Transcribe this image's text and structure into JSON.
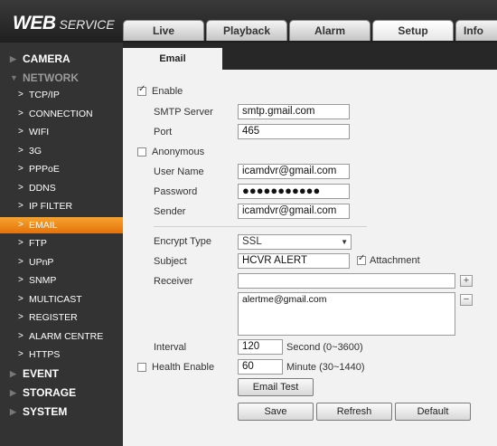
{
  "app": {
    "logo_main": "WEB",
    "logo_sub": "SERVICE"
  },
  "nav_tabs": [
    {
      "label": "Live"
    },
    {
      "label": "Playback"
    },
    {
      "label": "Alarm"
    },
    {
      "label": "Setup",
      "active": true
    },
    {
      "label": "Info"
    }
  ],
  "sidebar": {
    "camera": "CAMERA",
    "network": "NETWORK",
    "items": [
      "TCP/IP",
      "CONNECTION",
      "WIFI",
      "3G",
      "PPPoE",
      "DDNS",
      "IP FILTER",
      "EMAIL",
      "FTP",
      "UPnP",
      "SNMP",
      "MULTICAST",
      "REGISTER",
      "ALARM CENTRE",
      "HTTPS"
    ],
    "active_item": "EMAIL",
    "event": "EVENT",
    "storage": "STORAGE",
    "system": "SYSTEM"
  },
  "sub_tab": "Email",
  "form": {
    "enable": {
      "label": "Enable",
      "checked": true
    },
    "smtp_server": {
      "label": "SMTP Server",
      "value": "smtp.gmail.com"
    },
    "port": {
      "label": "Port",
      "value": "465"
    },
    "anonymous": {
      "label": "Anonymous",
      "checked": false
    },
    "user_name": {
      "label": "User Name",
      "value": "icamdvr@gmail.com"
    },
    "password": {
      "label": "Password",
      "value": "●●●●●●●●●●●"
    },
    "sender": {
      "label": "Sender",
      "value": "icamdvr@gmail.com"
    },
    "encrypt_type": {
      "label": "Encrypt Type",
      "value": "SSL"
    },
    "subject": {
      "label": "Subject",
      "value": "HCVR ALERT"
    },
    "attachment": {
      "label": "Attachment",
      "checked": true
    },
    "receiver": {
      "label": "Receiver",
      "value": "",
      "list": [
        "alertme@gmail.com"
      ]
    },
    "interval": {
      "label": "Interval",
      "value": "120",
      "unit": "Second (0~3600)"
    },
    "health_enable": {
      "label": "Health Enable",
      "checked": false,
      "value": "60",
      "unit": "Minute (30~1440)"
    }
  },
  "buttons": {
    "add": "+",
    "remove": "−",
    "email_test": "Email Test",
    "save": "Save",
    "refresh": "Refresh",
    "default": "Default"
  },
  "colors": {
    "active_orange": "#f08a1c",
    "sidebar_bg": "#333333",
    "content_bg": "#f2f2f2"
  }
}
